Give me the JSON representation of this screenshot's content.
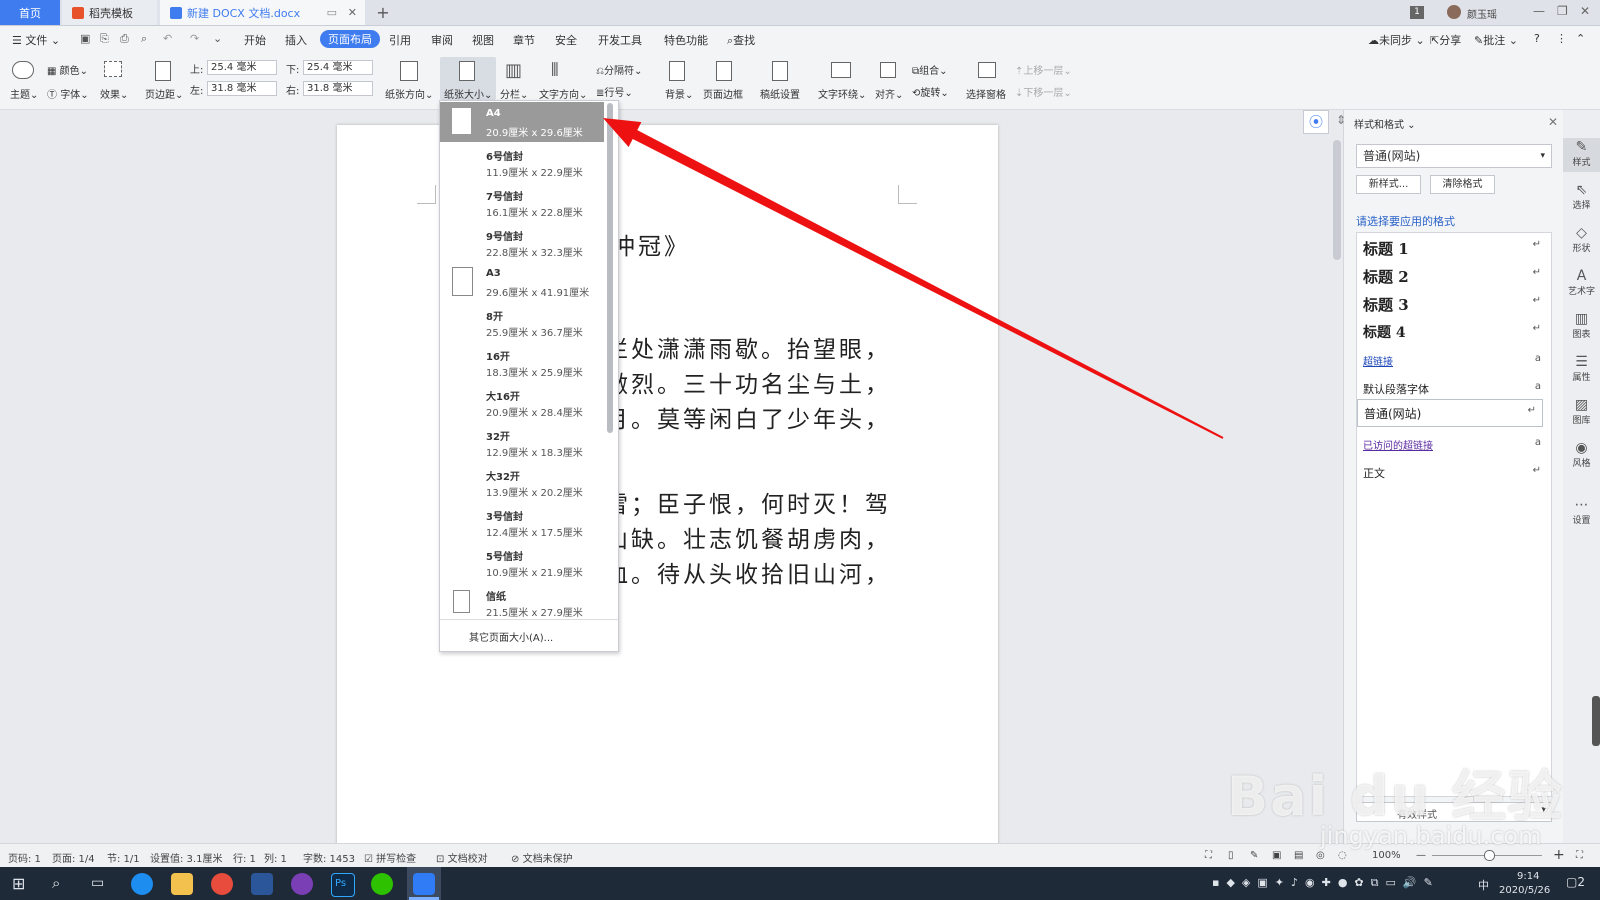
{
  "titlebar": {
    "tabs": [
      "首页",
      "稻壳模板",
      "新建 DOCX 文档.docx"
    ],
    "badge": "1",
    "user": "颜玉瑶"
  },
  "menubar": {
    "file": "文件",
    "items": [
      "开始",
      "插入",
      "页面布局",
      "引用",
      "审阅",
      "视图",
      "章节",
      "安全",
      "开发工具",
      "特色功能"
    ],
    "search": "查找",
    "right": [
      "未同步",
      "分享",
      "批注"
    ]
  },
  "ribbon": {
    "theme": "主题",
    "color": "颜色",
    "font": "字体",
    "effect": "效果",
    "margin": "页边距",
    "top_label": "上:",
    "top_value": "25.4 毫米",
    "bottom_label": "下:",
    "bottom_value": "25.4 毫米",
    "left_label": "左:",
    "left_value": "31.8 毫米",
    "right_label": "右:",
    "right_value": "31.8 毫米",
    "orientation": "纸张方向",
    "paper_size": "纸张大小",
    "columns": "分栏",
    "text_direction": "文字方向",
    "breaks": "分隔符",
    "line_numbers": "行号",
    "background": "背景",
    "page_border": "页面边框",
    "draft_setup": "稿纸设置",
    "text_wrap": "文字环绕",
    "align": "对齐",
    "group": "组合",
    "rotate": "旋转",
    "selection_pane": "选择窗格",
    "bring_forward": "上移一层",
    "send_backward": "下移一层"
  },
  "document": {
    "title_fragment": "冲冠》",
    "lines": [
      "栏处潇潇雨歇。抬望眼，",
      "激烈。三十功名尘与土，",
      "月。莫等闲白了少年头，",
      "雪；臣子恨，何时灭！驾",
      "山缺。壮志饥餐胡虏肉，",
      "血。待从头收拾旧山河，"
    ]
  },
  "paper_menu": {
    "items": [
      {
        "name": "A4",
        "size": "20.9厘米 x 29.6厘米"
      },
      {
        "name": "6号信封",
        "size": "11.9厘米 x 22.9厘米"
      },
      {
        "name": "7号信封",
        "size": "16.1厘米 x 22.8厘米"
      },
      {
        "name": "9号信封",
        "size": "22.8厘米 x 32.3厘米"
      },
      {
        "name": "A3",
        "size": "29.6厘米 x 41.91厘米"
      },
      {
        "name": "8开",
        "size": "25.9厘米 x 36.7厘米"
      },
      {
        "name": "16开",
        "size": "18.3厘米 x 25.9厘米"
      },
      {
        "name": "大16开",
        "size": "20.9厘米 x 28.4厘米"
      },
      {
        "name": "32开",
        "size": "12.9厘米 x 18.3厘米"
      },
      {
        "name": "大32开",
        "size": "13.9厘米 x 20.2厘米"
      },
      {
        "name": "3号信封",
        "size": "12.4厘米 x 17.5厘米"
      },
      {
        "name": "5号信封",
        "size": "10.9厘米 x 21.9厘米"
      },
      {
        "name": "信纸",
        "size": "21.5厘米 x 27.9厘米"
      }
    ],
    "selected": "A4",
    "more": "其它页面大小(A)..."
  },
  "style_panel": {
    "title": "样式和格式",
    "current": "普通(网站)",
    "new_style": "新样式...",
    "clear_format": "清除格式",
    "prompt": "请选择要应用的格式",
    "styles": [
      "标题 1",
      "标题 2",
      "标题 3",
      "标题 4",
      "超链接",
      "默认段落字体",
      "普通(网站)",
      "已访问的超链接",
      "正文"
    ],
    "show_label": "有效样式"
  },
  "side_icons": [
    "样式",
    "选择",
    "形状",
    "艺术字",
    "图表",
    "属性",
    "图库",
    "风格",
    "设置"
  ],
  "statusbar": {
    "items": [
      "页码: 1",
      "页面: 1/4",
      "节: 1/1",
      "设置值: 3.1厘米",
      "行: 1",
      "列: 1",
      "字数: 1453",
      "拼写检查",
      "文档校对",
      "文档未保护"
    ],
    "zoom": "100%"
  },
  "taskbar": {
    "time": "9:14",
    "date": "2020/5/26",
    "ime": "中",
    "notifications": "2"
  },
  "watermark": {
    "text": "Bai du 经验",
    "url": "jingyan.baidu.com"
  },
  "colors": {
    "accent": "#3e7cf0",
    "arrow": "#ee1111",
    "taskbar": "#1f2a38"
  }
}
